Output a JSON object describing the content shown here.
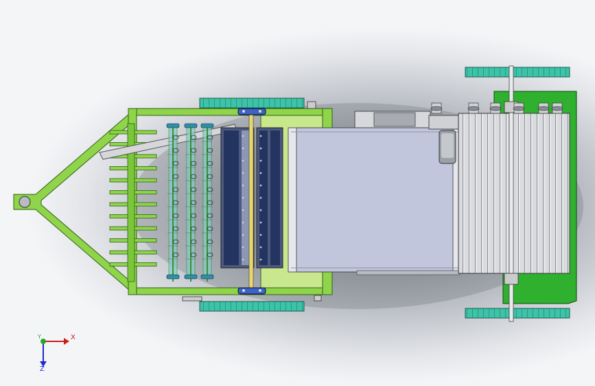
{
  "viewport": {
    "background_gradient": [
      "#f4f5f7",
      "#6f7580"
    ]
  },
  "model": {
    "colors": {
      "frame": "#8fd44a",
      "frame_dark": "#3f7f1e",
      "wheel": "#3cc3a8",
      "wheel_dark": "#1e7d6c",
      "bearing": "#3a62c8",
      "belt": "#c2c6dd",
      "roller": "#2a3d6e",
      "cylinder": "#d4d6da",
      "hopper": "#2fb02f",
      "part_outline": "#222222"
    },
    "parts": [
      "hitch",
      "tine-bar",
      "pickup-rollers",
      "drive-shaft",
      "rotary-drum",
      "conveyor-belt",
      "bale-chamber",
      "gearbox",
      "transport-wheels"
    ]
  },
  "triad": {
    "x_label": "X",
    "y_label": "Y",
    "z_label": "Z",
    "x_color": "#d01a1a",
    "y_color": "#2aa52a",
    "z_color": "#1a2ad0"
  }
}
